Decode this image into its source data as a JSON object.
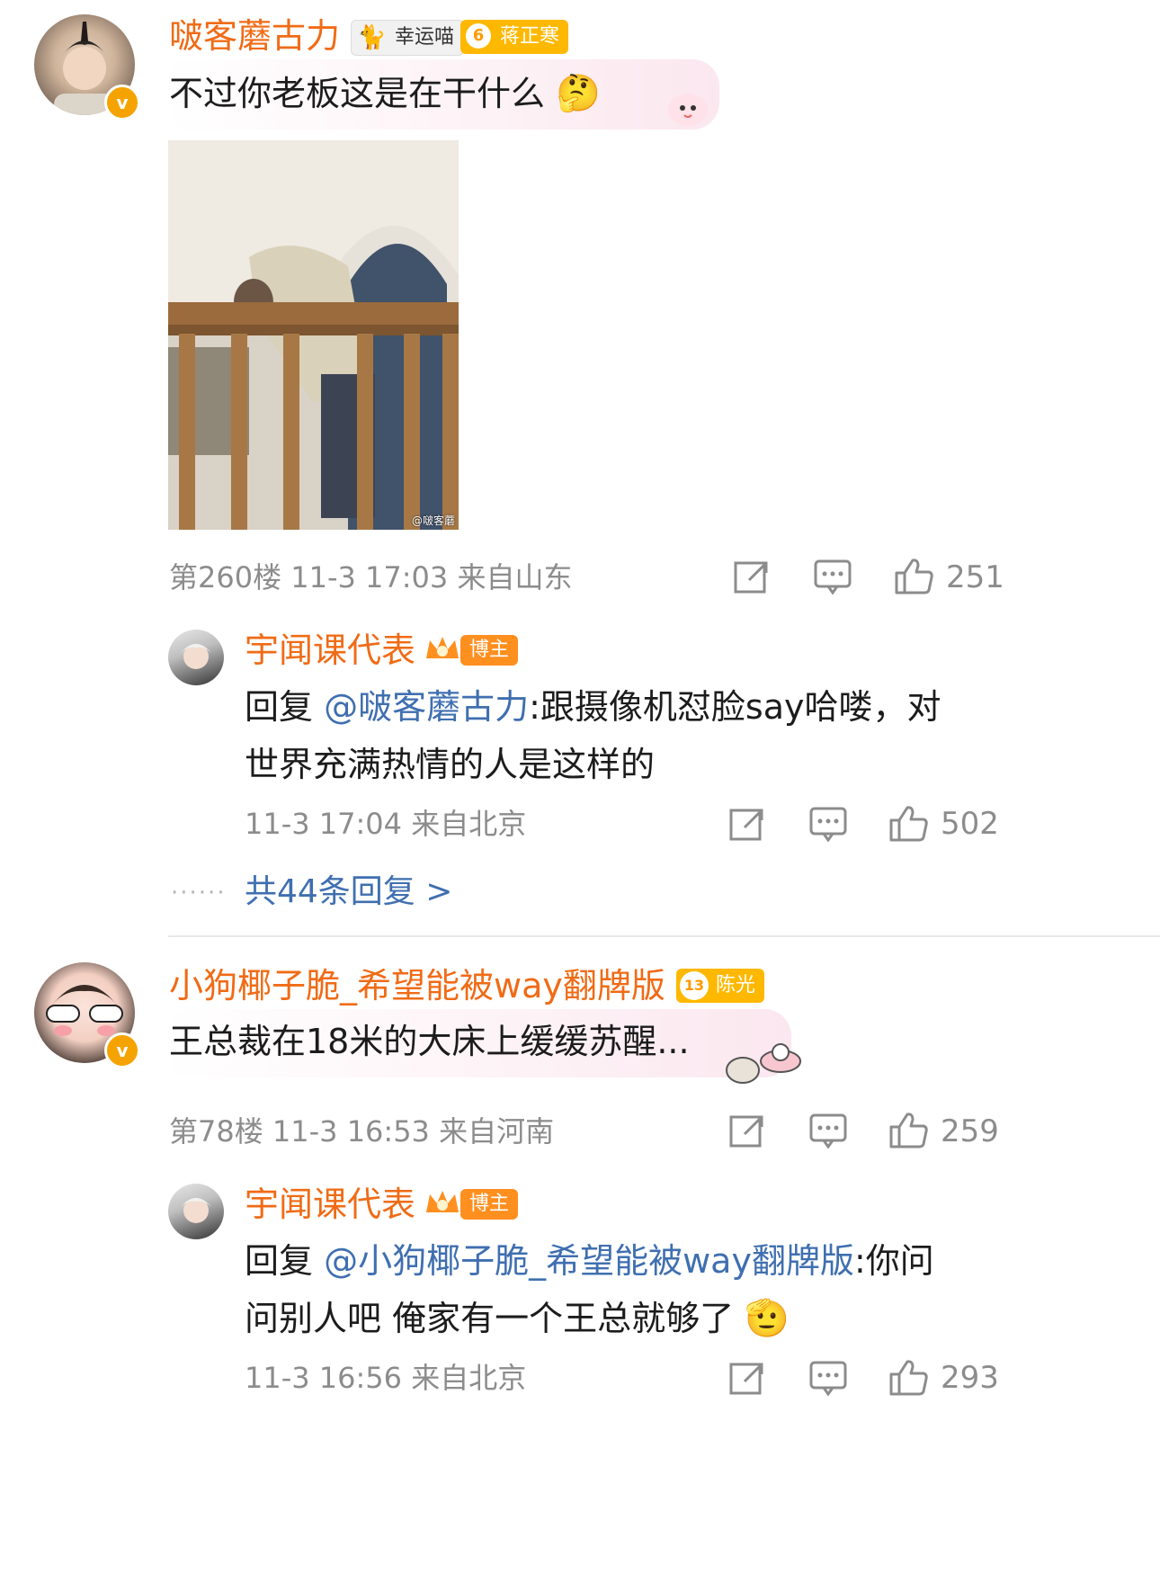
{
  "comments": [
    {
      "username": "啵客蘑古力",
      "badge_gray": "幸运喵",
      "badge_fan_level": "6",
      "badge_fan_name": "蒋正寒",
      "text": "不过你老板这是在干什么",
      "floor_meta": "第260楼 11-3 17:03 来自山东",
      "likes": "251",
      "image_watermark": "@啵客蘑",
      "reply": {
        "username": "宇闻课代表",
        "badge": "博主",
        "prefix": "回复 ",
        "mention": "@啵客蘑古力",
        "text_line1": ":跟摄像机怼脸say哈喽，对",
        "text_line2": "世界充满热情的人是这样的",
        "meta": "11-3 17:04  来自北京",
        "likes": "502"
      },
      "more_replies": "共44条回复 >"
    },
    {
      "username": "小狗椰子脆_希望能被way翻牌版",
      "badge_fan_level": "13",
      "badge_fan_name": "陈光",
      "text": "王总裁在18米的大床上缓缓苏醒...",
      "floor_meta": "第78楼 11-3 16:53  来自河南",
      "likes": "259",
      "reply": {
        "username": "宇闻课代表",
        "badge": "博主",
        "prefix": "回复 ",
        "mention": "@小狗椰子脆_希望能被way翻牌版",
        "text_line1": ":你问",
        "text_line2": "问别人吧 俺家有一个王总就够了",
        "meta": "11-3 16:56  来自北京",
        "likes": "293"
      }
    }
  ],
  "icons": [
    "share-icon",
    "comment-icon",
    "like-icon",
    "verified-icon"
  ],
  "colors": {
    "username": "#f06b16",
    "mention": "#3f6fb0",
    "meta": "#8c8c8c",
    "verified": "#f5a300"
  }
}
